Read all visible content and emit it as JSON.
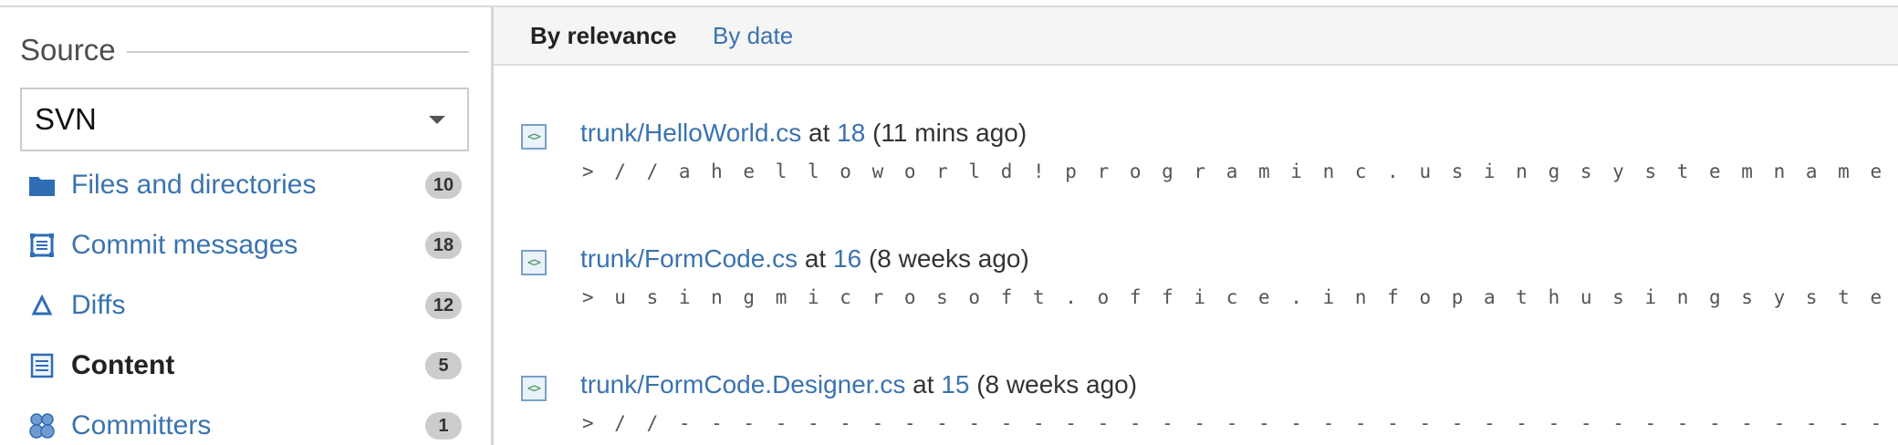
{
  "sidebar": {
    "source_title": "Source",
    "select_value": "SVN",
    "items": [
      {
        "label": "Files and directories",
        "count": "10",
        "icon": "folder-icon",
        "active": false
      },
      {
        "label": "Commit messages",
        "count": "18",
        "icon": "commit-icon",
        "active": false
      },
      {
        "label": "Diffs",
        "count": "12",
        "icon": "diff-icon",
        "active": false
      },
      {
        "label": "Content",
        "count": "5",
        "icon": "document-icon",
        "active": true
      },
      {
        "label": "Committers",
        "count": "1",
        "icon": "users-icon",
        "active": false
      }
    ]
  },
  "main": {
    "tabs": [
      {
        "label": "By relevance",
        "active": true
      },
      {
        "label": "By date",
        "active": false
      }
    ],
    "results": [
      {
        "path": "trunk/HelloWorld.cs",
        "at": "at",
        "revision": "18",
        "ago": "(11 mins ago)",
        "snippet": "> / / a h e l l o w o r l d ! p r o g r a m i n c . u s i n g s y s t e m n a m e s p a c e h . . ."
      },
      {
        "path": "trunk/FormCode.cs",
        "at": "at",
        "revision": "16",
        "ago": "(8 weeks ago)",
        "snippet": "> u s i n g m i c r o s o f t . o f f i c e . i n f o p a t h u s i n g s y s t e m u s i n g s y s"
      },
      {
        "path": "trunk/FormCode.Designer.cs",
        "at": "at",
        "revision": "15",
        "ago": "(8 weeks ago)",
        "snippet": "> / / - - - - - - - - - - - - - - - - - - - - - - - - - - - - - - - - - - - - - - - - - - - - - - - -"
      }
    ]
  },
  "colors": {
    "link": "#3b73af",
    "badge": "#cccccc",
    "divider": "#d6d6d6"
  }
}
